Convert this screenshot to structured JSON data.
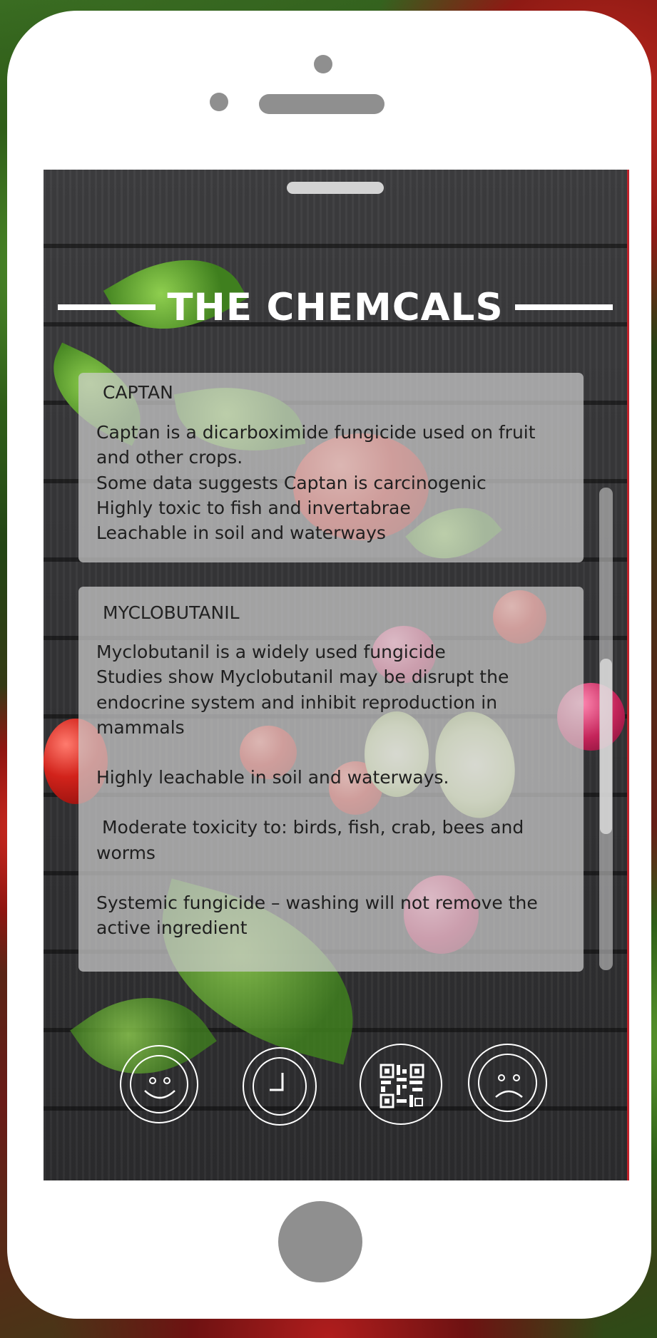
{
  "screen": {
    "title": "THE CHEMCALS",
    "cards": [
      {
        "name": "CAPTAN",
        "lines": [
          "Captan is a dicarboximide fungicide used on fruit and other crops.",
          "Some data suggests Captan is carcinogenic",
          "Highly toxic to fish and invertabrae",
          "Leachable in soil and waterways"
        ]
      },
      {
        "name": "MYCLOBUTANIL",
        "lines": [
          "Myclobutanil is a widely used fungicide",
          "Studies show Myclobutanil may be disrupt the endocrine system and inhibit reproduction in mammals",
          "Highly leachable in soil and waterways.",
          " Moderate toxicity to: birds, fish, crab, bees and worms",
          "Systemic fungicide – washing will not remove the active ingredient"
        ]
      }
    ],
    "nav": [
      {
        "icon": "happy-face-icon"
      },
      {
        "icon": "clock-icon"
      },
      {
        "icon": "qr-code-icon"
      },
      {
        "icon": "sad-face-icon"
      }
    ]
  },
  "colors": {
    "phone_body": "#ffffff",
    "phone_accents": "#8f8f8f",
    "card_background": "rgba(205,205,205,0.72)",
    "screen_border_accent": "#c0232b"
  }
}
